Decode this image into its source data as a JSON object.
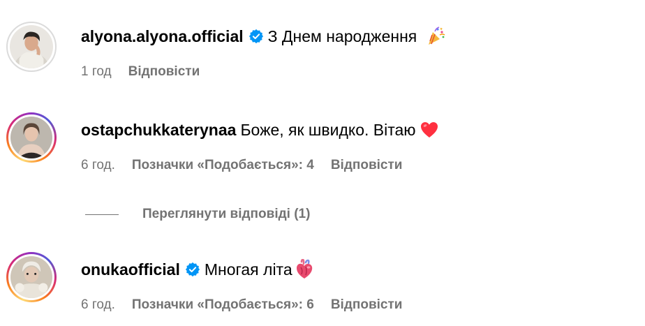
{
  "comments": [
    {
      "username": "alyona.alyona.official",
      "verified": true,
      "avatar_ring": "none",
      "text": "З Днем народження",
      "emoji": "party-popper-icon",
      "time": "1 год",
      "likes": "",
      "reply_label": "Відповісти"
    },
    {
      "username": "ostapchukkaterynaa",
      "verified": false,
      "avatar_ring": "story-gradient",
      "text": "Боже, як швидко. Вітаю",
      "emoji": "red-heart-icon",
      "time": "6 год.",
      "likes": "Позначки «Подобається»: 4",
      "reply_label": "Відповісти"
    },
    {
      "username": "onukaofficial",
      "verified": true,
      "avatar_ring": "story-gradient",
      "text": "Многая літа",
      "emoji": "anatomical-heart-icon",
      "time": "6 год.",
      "likes": "Позначки «Подобається»: 6",
      "reply_label": "Відповісти"
    }
  ],
  "view_replies": "Переглянути відповіді (1)",
  "colors": {
    "text_primary": "#000000",
    "text_secondary": "#737373",
    "verified_blue": "#0095f6",
    "heart_red": "#ff3040"
  }
}
